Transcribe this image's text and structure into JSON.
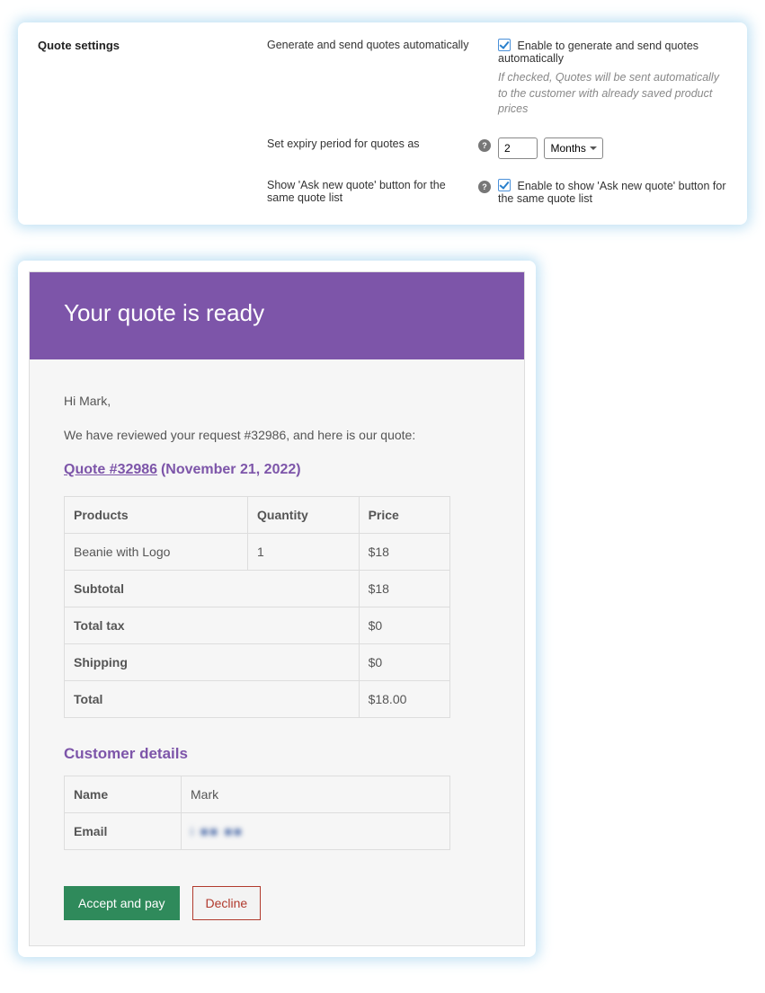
{
  "settings": {
    "section_title": "Quote settings",
    "row1": {
      "label": "Generate and send quotes automatically",
      "checkbox_label": "Enable to generate and send quotes automatically",
      "checked": true,
      "note": "If checked, Quotes will be sent automatically to the customer with already saved product prices"
    },
    "row2": {
      "label": "Set expiry period for quotes as",
      "value": "2",
      "unit": "Months"
    },
    "row3": {
      "label": "Show 'Ask new quote' button for the same quote list",
      "checkbox_label": "Enable to show 'Ask new quote' button for the same quote list",
      "checked": true
    }
  },
  "email": {
    "header": "Your quote is ready",
    "greeting": "Hi Mark,",
    "intro": "We have reviewed your request #32986, and here is our quote:",
    "quote_link_text": "Quote #32986",
    "quote_date": "(November 21, 2022)",
    "table": {
      "headers": {
        "products": "Products",
        "qty": "Quantity",
        "price": "Price"
      },
      "items": [
        {
          "name": "Beanie with Logo",
          "qty": "1",
          "price": "$18"
        }
      ],
      "subtotal": {
        "label": "Subtotal",
        "value": "$18"
      },
      "tax": {
        "label": "Total tax",
        "value": "$0"
      },
      "shipping": {
        "label": "Shipping",
        "value": "$0"
      },
      "total": {
        "label": "Total",
        "value": "$18.00"
      }
    },
    "customer": {
      "title": "Customer details",
      "name_label": "Name",
      "name_value": "Mark",
      "email_label": "Email",
      "email_value": "i   ■■   ■■"
    },
    "buttons": {
      "accept": "Accept and pay",
      "decline": "Decline"
    }
  }
}
